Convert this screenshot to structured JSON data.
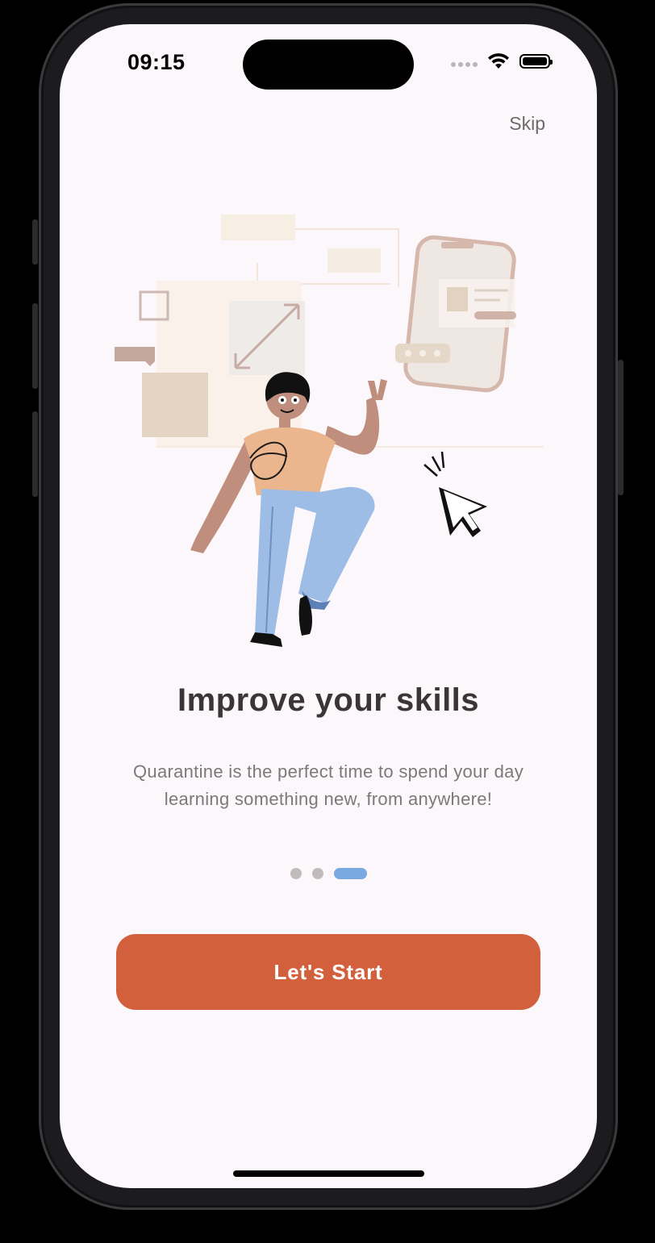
{
  "status_bar": {
    "time": "09:15"
  },
  "onboarding": {
    "skip_label": "Skip",
    "title": "Improve your skills",
    "description": "Quarantine is the perfect time to spend your day learning something new, from anywhere!",
    "page_indicator": {
      "total": 3,
      "current": 3
    },
    "start_button_label": "Let's Start"
  },
  "colors": {
    "background": "#fcf7fb",
    "accent_button": "#d2603d",
    "active_dot": "#7aa8e0",
    "inactive_dot": "#c1bcbb",
    "title_text": "#3b3536",
    "body_text": "#7d7879"
  },
  "icons": {
    "signal": "signal-dots-icon",
    "wifi": "wifi-icon",
    "battery": "battery-icon",
    "illustration": "person-with-phone-illustration"
  }
}
